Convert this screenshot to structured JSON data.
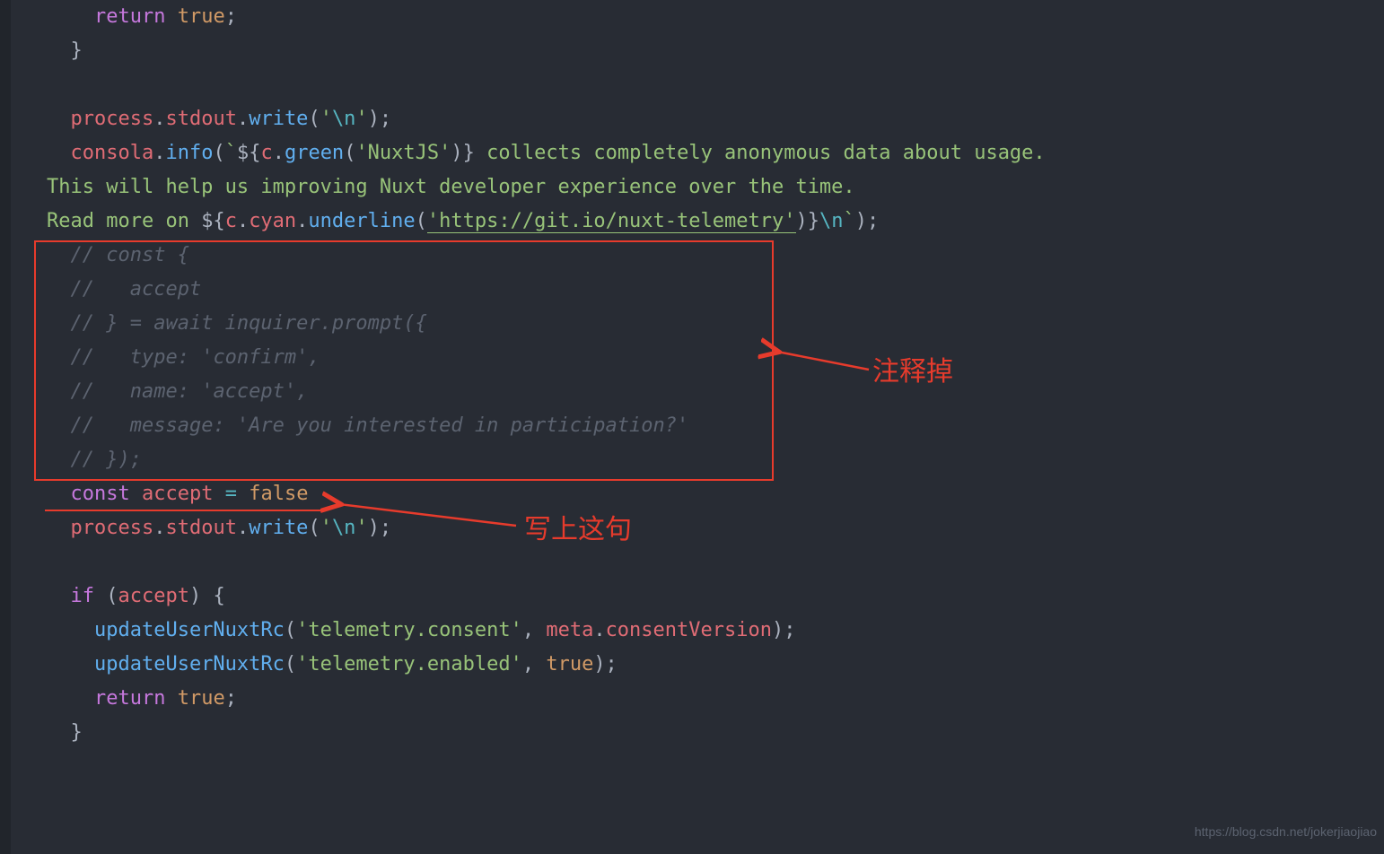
{
  "code": {
    "l1_return": "return",
    "l1_true": "true",
    "l3_process": "process",
    "l3_stdout": "stdout",
    "l3_write": "write",
    "l3_str_q": "'",
    "l3_esc": "\\n",
    "l4_consola": "consola",
    "l4_info": "info",
    "l4_tpl_open": "`",
    "l4_dollar_open": "${",
    "l4_c": "c",
    "l4_green": "green",
    "l4_nuxt": "'NuxtJS'",
    "l4_dollar_close": "}",
    "l4_rest": " collects completely anonymous data about usage.",
    "l5": "This will help us improving Nuxt developer experience over the time.",
    "l6_readmore": "Read more on ",
    "l6_c": "c",
    "l6_cyan": "cyan",
    "l6_underline": "underline",
    "l6_url": "'https://git.io/nuxt-telemetry'",
    "l6_close": "}",
    "l6_tail": "\\n`",
    "c1": "// const {",
    "c2": "//   accept",
    "c3": "// } = await inquirer.prompt({",
    "c4": "//   type: 'confirm',",
    "c5": "//   name: 'accept',",
    "c6": "//   message: 'Are you interested in participation?'",
    "c7": "// });",
    "l14_const": "const",
    "l14_accept": "accept",
    "l14_eq": " = ",
    "l14_false": "false",
    "l15_process": "process",
    "l15_stdout": "stdout",
    "l15_write": "write",
    "l16_if": "if",
    "l16_accept": "accept",
    "l17_fn": "updateUserNuxtRc",
    "l17_key": "'telemetry.consent'",
    "l17_meta": "meta",
    "l17_cv": "consentVersion",
    "l18_fn": "updateUserNuxtRc",
    "l18_key": "'telemetry.enabled'",
    "l18_true": "true",
    "l19_return": "return",
    "l19_true": "true"
  },
  "annotations": {
    "commented_out": "注释掉",
    "write_this": "写上这句"
  },
  "footer": "https://blog.csdn.net/jokerjiaojiao"
}
